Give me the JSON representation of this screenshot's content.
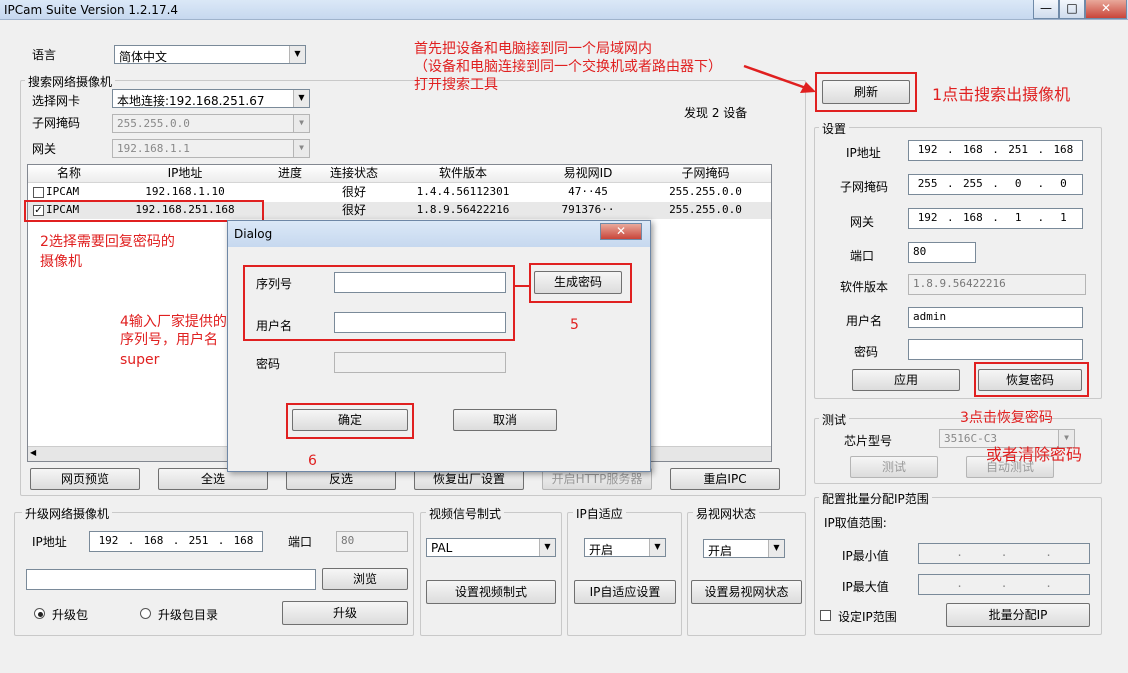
{
  "window": {
    "title": "IPCam Suite Version 1.2.17.4",
    "minimize": "—",
    "maximize": "□",
    "close": "✕"
  },
  "language": {
    "label": "语言",
    "value": "简体中文"
  },
  "search": {
    "group_label": "搜索网络摄像机",
    "nic_label": "选择网卡",
    "nic_value": "本地连接:192.168.251.67",
    "mask_label": "子网掩码",
    "mask_value": "255.255.0.0",
    "gateway_label": "网关",
    "gateway_value": "192.168.1.1",
    "found_text": "发现 2 设备"
  },
  "device_table": {
    "columns": [
      "名称",
      "IP地址",
      "进度",
      "连接状态",
      "软件版本",
      "易视网ID",
      "子网掩码"
    ],
    "rows": [
      {
        "checked": false,
        "name": "IPCAM",
        "ip": "192.168.1.10",
        "progress": "",
        "status": "很好",
        "version": "1.4.4.56112301",
        "yid": "47··45",
        "mask": "255.255.0.0"
      },
      {
        "checked": true,
        "name": "IPCAM",
        "ip": "192.168.251.168",
        "progress": "",
        "status": "很好",
        "version": "1.8.9.56422216",
        "yid": "791376··",
        "mask": "255.255.0.0"
      }
    ]
  },
  "bottom_buttons": [
    "网页预览",
    "全选",
    "反选",
    "恢复出厂设置",
    "开启HTTP服务器",
    "重启IPC"
  ],
  "refresh_button": "刷新",
  "settings": {
    "group_label": "设置",
    "ip_label": "IP地址",
    "ip": [
      "192",
      "168",
      "251",
      "168"
    ],
    "mask_label": "子网掩码",
    "mask": [
      "255",
      "255",
      "0",
      "0"
    ],
    "gateway_label": "网关",
    "gateway": [
      "192",
      "168",
      "1",
      "1"
    ],
    "port_label": "端口",
    "port": "80",
    "version_label": "软件版本",
    "version": "1.8.9.56422216",
    "user_label": "用户名",
    "user": "admin",
    "pass_label": "密码",
    "pass": "",
    "apply_button": "应用",
    "recover_button": "恢复密码"
  },
  "test": {
    "group_label": "测试",
    "chip_label": "芯片型号",
    "chip_value": "3516C-C3",
    "test_button": "测试",
    "auto_test_button": "自动测试"
  },
  "batch": {
    "group_label": "配置批量分配IP范围",
    "range_label": "IP取值范围:",
    "min_label": "IP最小值",
    "max_label": "IP最大值",
    "set_range_label": "设定IP范围",
    "assign_button": "批量分配IP"
  },
  "upgrade": {
    "group_label": "升级网络摄像机",
    "ip_label": "IP地址",
    "ip": [
      "192",
      "168",
      "251",
      "168"
    ],
    "port_label": "端口",
    "port": "80",
    "browse_button": "浏览",
    "radio_pkg": "升级包",
    "radio_dir": "升级包目录",
    "upgrade_button": "升级"
  },
  "video": {
    "group_label": "视频信号制式",
    "value": "PAL",
    "button": "设置视频制式"
  },
  "ipadapt": {
    "group_label": "IP自适应",
    "value": "开启",
    "button": "IP自适应设置"
  },
  "yishi": {
    "group_label": "易视网状态",
    "value": "开启",
    "button": "设置易视网状态"
  },
  "dialog": {
    "title": "Dialog",
    "close": "✕",
    "serial_label": "序列号",
    "serial": "",
    "user_label": "用户名",
    "user": "",
    "pass_label": "密码",
    "pass": "",
    "generate_button": "生成密码",
    "ok_button": "确定",
    "cancel_button": "取消"
  },
  "annotations": {
    "top_line1": "首先把设备和电脑接到同一个局域网内",
    "top_line2": "（设备和电脑连接到同一个交换机或者路由器下）",
    "top_line3": "打开搜索工具",
    "step1": "1点击搜索出摄像机",
    "step2_line1": "2选择需要回复密码的",
    "step2_line2": "摄像机",
    "step3_line1": "3点击恢复密码",
    "step3_line2": "或者清除密码",
    "step4_line1": "4输入厂家提供的",
    "step4_line2": "序列号，用户名",
    "step4_line3": "super",
    "step5": "5",
    "step6": "6"
  },
  "colors": {
    "annotation": "#e02020",
    "titlebar": "#c6d8ef"
  }
}
